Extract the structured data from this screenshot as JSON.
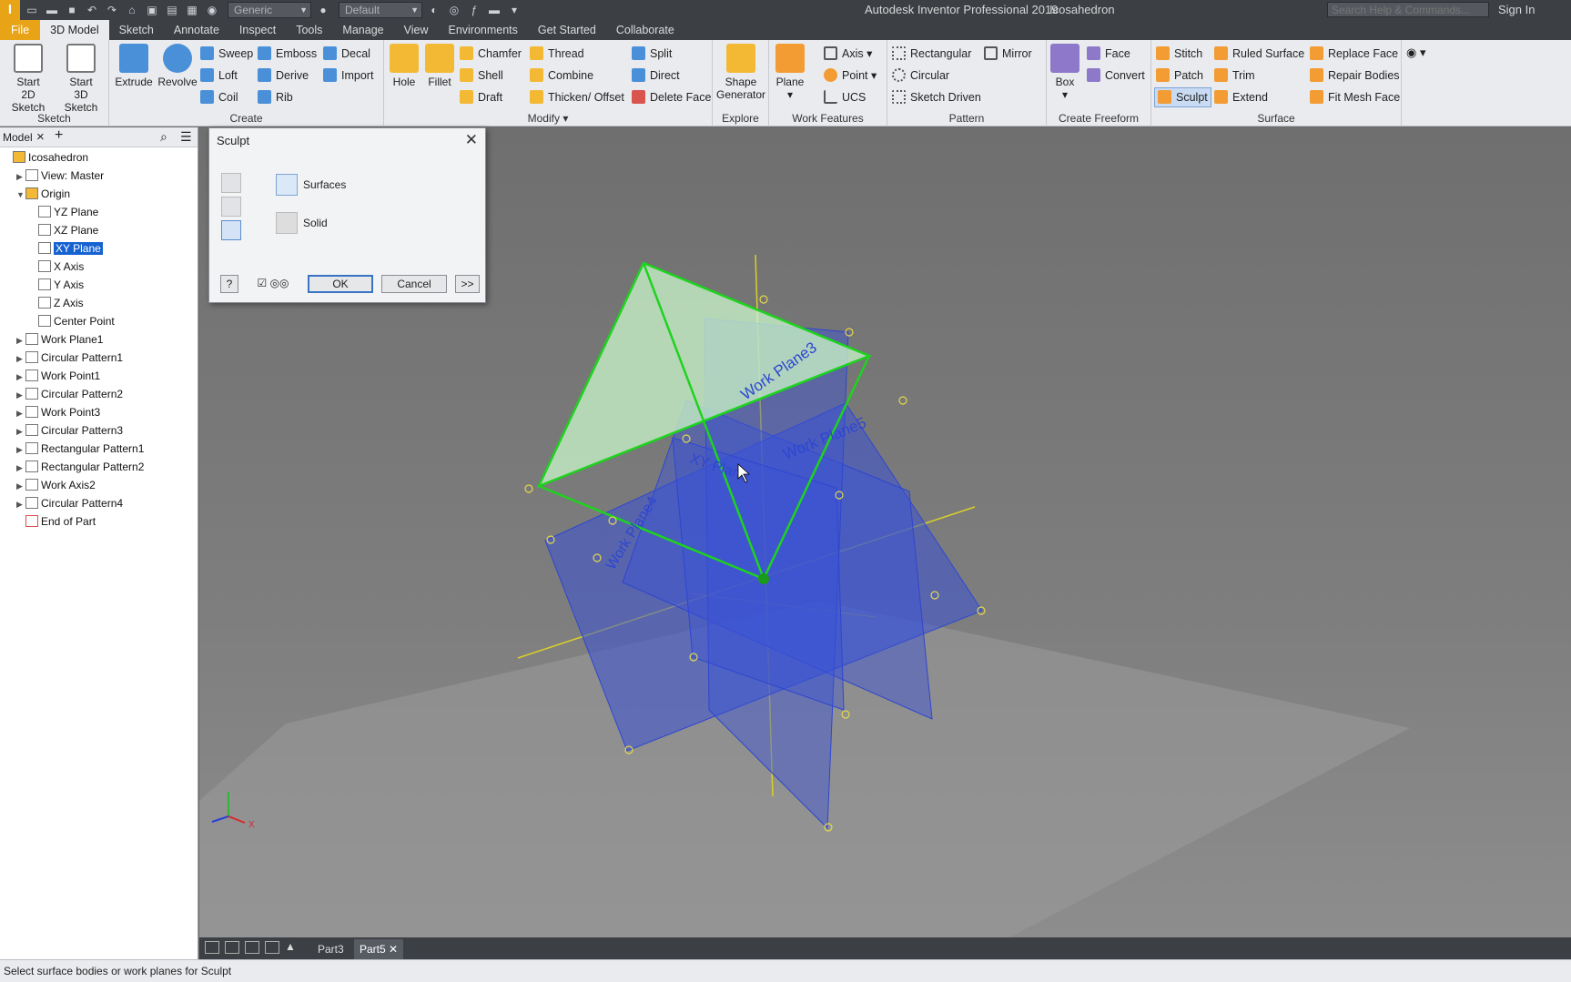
{
  "titlebar": {
    "app_title": "Autodesk Inventor Professional 2019",
    "doc_title": "Icosahedron",
    "material": "Generic",
    "appearance": "Default",
    "search_placeholder": "Search Help & Commands...",
    "signin": "Sign In"
  },
  "tabs": [
    "File",
    "3D Model",
    "Sketch",
    "Annotate",
    "Inspect",
    "Tools",
    "Manage",
    "View",
    "Environments",
    "Get Started",
    "Collaborate"
  ],
  "ribbon": {
    "sketch": {
      "label": "Sketch",
      "start2d": [
        "Start",
        "2D Sketch"
      ],
      "start3d": [
        "Start",
        "3D Sketch"
      ]
    },
    "create": {
      "label": "Create",
      "extrude": "Extrude",
      "revolve": "Revolve",
      "sweep": "Sweep",
      "loft": "Loft",
      "coil": "Coil",
      "emboss": "Emboss",
      "derive": "Derive",
      "rib": "Rib",
      "decal": "Decal",
      "import": "Import"
    },
    "modify": {
      "label": "Modify",
      "hole": "Hole",
      "fillet": "Fillet",
      "chamfer": "Chamfer",
      "shell": "Shell",
      "draft": "Draft",
      "thread": "Thread",
      "combine": "Combine",
      "thicken": "Thicken/ Offset",
      "split": "Split",
      "direct": "Direct",
      "delete_face": "Delete Face"
    },
    "explore": {
      "label": "Explore",
      "shape_gen": [
        "Shape",
        "Generator"
      ]
    },
    "work": {
      "label": "Work Features",
      "plane": "Plane",
      "axis": "Axis",
      "point": "Point",
      "ucs": "UCS"
    },
    "pattern": {
      "label": "Pattern",
      "rectangular": "Rectangular",
      "circular": "Circular",
      "sketch_driven": "Sketch Driven",
      "mirror": "Mirror"
    },
    "freeform": {
      "label": "Create Freeform",
      "box": "Box",
      "face": "Face",
      "convert": "Convert"
    },
    "surface": {
      "label": "Surface",
      "stitch": "Stitch",
      "patch": "Patch",
      "sculpt": "Sculpt",
      "ruled": "Ruled Surface",
      "trim": "Trim",
      "extend": "Extend",
      "replace": "Replace Face",
      "repair": "Repair Bodies",
      "fitmesh": "Fit Mesh Face"
    }
  },
  "browser": {
    "tab": "Model",
    "nodes": [
      {
        "label": "Icosahedron",
        "level": 0,
        "exp": ""
      },
      {
        "label": "View: Master",
        "level": 1,
        "exp": "▶"
      },
      {
        "label": "Origin",
        "level": 1,
        "exp": "▼"
      },
      {
        "label": "YZ Plane",
        "level": 2,
        "exp": ""
      },
      {
        "label": "XZ Plane",
        "level": 2,
        "exp": ""
      },
      {
        "label": "XY Plane",
        "level": 2,
        "exp": ""
      },
      {
        "label": "X Axis",
        "level": 2,
        "exp": ""
      },
      {
        "label": "Y Axis",
        "level": 2,
        "exp": ""
      },
      {
        "label": "Z Axis",
        "level": 2,
        "exp": ""
      },
      {
        "label": "Center Point",
        "level": 2,
        "exp": ""
      },
      {
        "label": "Work Plane1",
        "level": 1,
        "exp": "▶"
      },
      {
        "label": "Circular Pattern1",
        "level": 1,
        "exp": "▶"
      },
      {
        "label": "Work Point1",
        "level": 1,
        "exp": "▶"
      },
      {
        "label": "Circular Pattern2",
        "level": 1,
        "exp": "▶"
      },
      {
        "label": "Work Point3",
        "level": 1,
        "exp": "▶"
      },
      {
        "label": "Circular Pattern3",
        "level": 1,
        "exp": "▶"
      },
      {
        "label": "Rectangular Pattern1",
        "level": 1,
        "exp": "▶"
      },
      {
        "label": "Rectangular Pattern2",
        "level": 1,
        "exp": "▶"
      },
      {
        "label": "Work Axis2",
        "level": 1,
        "exp": "▶"
      },
      {
        "label": "Circular Pattern4",
        "level": 1,
        "exp": "▶"
      },
      {
        "label": "End of Part",
        "level": 1,
        "exp": ""
      }
    ]
  },
  "dialog": {
    "title": "Sculpt",
    "surfaces": "Surfaces",
    "solid": "Solid",
    "ok": "OK",
    "cancel": "Cancel",
    "more": ">>"
  },
  "viewport": {
    "labels": {
      "wp3": "Work Plane3",
      "wp5": "Work Plane5",
      "wp4": "Work Plane4",
      "xy": "XY Plane"
    }
  },
  "doctabs": [
    "Part3",
    "Part5"
  ],
  "status": "Select surface bodies or work planes for Sculpt",
  "colors": {
    "accent": "#e8a317",
    "plane_blue": "#3a52d6",
    "highlight_green": "#1ed31e",
    "selection": "#1662d1"
  }
}
